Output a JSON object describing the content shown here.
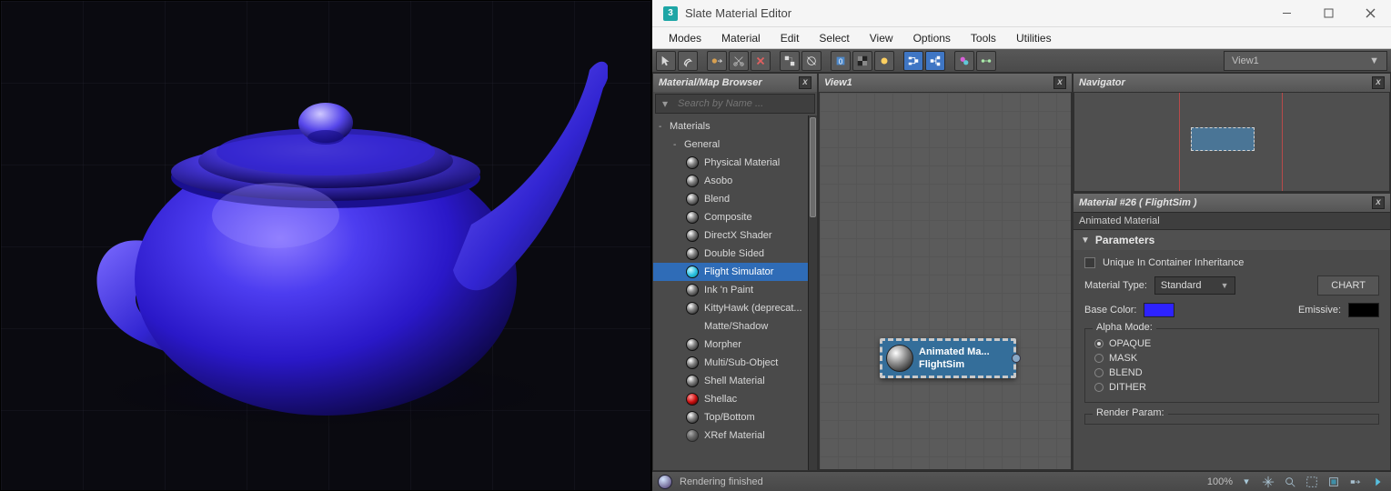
{
  "window": {
    "title": "Slate Material Editor",
    "app_icon_glyph": "3"
  },
  "menu": [
    "Modes",
    "Material",
    "Edit",
    "Select",
    "View",
    "Options",
    "Tools",
    "Utilities"
  ],
  "toolbar": {
    "view_dropdown": "View1"
  },
  "browser": {
    "title": "Material/Map Browser",
    "search_placeholder": "Search by Name ...",
    "root": "Materials",
    "group": "General",
    "items": [
      {
        "label": "Physical Material",
        "sphere": "default"
      },
      {
        "label": "Asobo",
        "sphere": "default"
      },
      {
        "label": "Blend",
        "sphere": "default"
      },
      {
        "label": "Composite",
        "sphere": "default"
      },
      {
        "label": "DirectX Shader",
        "sphere": "default"
      },
      {
        "label": "Double Sided",
        "sphere": "default"
      },
      {
        "label": "Flight Simulator",
        "sphere": "cyan",
        "selected": true
      },
      {
        "label": "Ink 'n Paint",
        "sphere": "default"
      },
      {
        "label": "KittyHawk (deprecat...",
        "sphere": "default"
      },
      {
        "label": "Matte/Shadow",
        "sphere": "none"
      },
      {
        "label": "Morpher",
        "sphere": "default"
      },
      {
        "label": "Multi/Sub-Object",
        "sphere": "default"
      },
      {
        "label": "Shell Material",
        "sphere": "default"
      },
      {
        "label": "Shellac",
        "sphere": "red"
      },
      {
        "label": "Top/Bottom",
        "sphere": "default"
      },
      {
        "label": "XRef Material",
        "sphere": "faded"
      }
    ]
  },
  "graph": {
    "title": "View1",
    "node": {
      "line1": "Animated Ma...",
      "line2": "FlightSim"
    }
  },
  "navigator": {
    "title": "Navigator"
  },
  "properties": {
    "header": "Material #26  ( FlightSim )",
    "subheader": "Animated Material",
    "rollout": "Parameters",
    "unique_label": "Unique In Container Inheritance",
    "material_type_label": "Material Type:",
    "material_type_value": "Standard",
    "chart_button": "CHART",
    "base_color_label": "Base Color:",
    "base_color_value": "#2d22ff",
    "emissive_label": "Emissive:",
    "emissive_value": "#000000",
    "alpha_mode_label": "Alpha Mode:",
    "alpha_modes": [
      "OPAQUE",
      "MASK",
      "BLEND",
      "DITHER"
    ],
    "alpha_mode_selected": 0,
    "render_param_label": "Render Param:"
  },
  "statusbar": {
    "message": "Rendering finished",
    "zoom": "100%"
  }
}
